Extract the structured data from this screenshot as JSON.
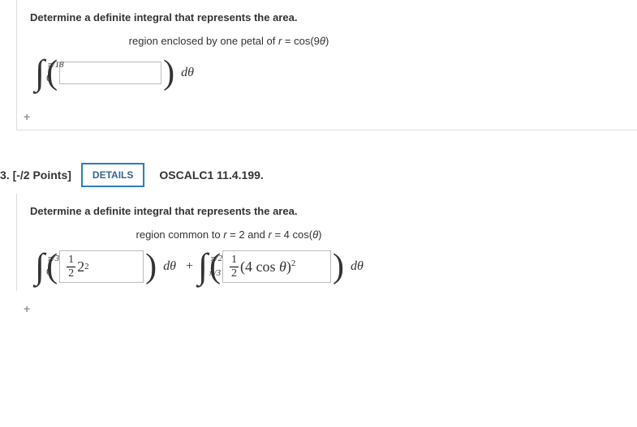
{
  "q1": {
    "prompt": "Determine a definite integral that represents the area.",
    "sub_prefix": "region enclosed by one petal of ",
    "sub_eq_lhs": "r",
    "sub_eq_rhs": " = cos(9",
    "sub_eq_tail": ")",
    "int_upper": "π/18",
    "int_lower": "0",
    "d_theta": "dθ",
    "input_value": ""
  },
  "header": {
    "number": "3.",
    "points": " [-/2 Points]",
    "details": "DETAILS",
    "ref": "OSCALC1 11.4.199."
  },
  "q2": {
    "prompt": "Determine a definite integral that represents the area.",
    "sub_prefix": "region common to ",
    "sub_eq1_lhs": "r",
    "sub_eq1_rhs": " = 2 and ",
    "sub_eq2_lhs": "r",
    "sub_eq2_rhs": " = 4 cos(",
    "sub_eq2_tail": ")",
    "int1_upper": "π/3",
    "int1_lower": "0",
    "ans1_frac_num": "1",
    "ans1_frac_den": "2",
    "ans1_base": "2",
    "ans1_pow": "2",
    "d_theta": "dθ",
    "plus": "+",
    "int2_upper": "π/2",
    "int2_lower": "π/3",
    "ans2_frac_num": "1",
    "ans2_frac_den": "2",
    "ans2_inner_a": "(4 cos ",
    "ans2_inner_b": ")",
    "ans2_pow": "2"
  },
  "glyphs": {
    "theta": "θ",
    "expand": "+"
  }
}
